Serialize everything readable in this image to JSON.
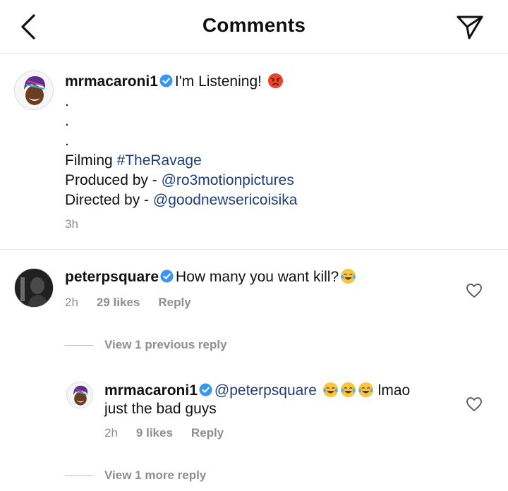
{
  "header": {
    "title": "Comments"
  },
  "caption": {
    "username": "mrmacaroni1",
    "text": "I'm Listening!",
    "dot": ".",
    "filming_label": "Filming",
    "filming_tag": "#TheRavage",
    "produced_label": "Produced by -",
    "produced_handle": "@ro3motionpictures",
    "directed_label": "Directed by -",
    "directed_handle": "@goodnewsericoisika",
    "time": "3h",
    "emoji": "angry-face-emoji"
  },
  "comment": {
    "username": "peterpsquare",
    "text": "How many you want kill?",
    "emoji": "tears-of-joy-emoji",
    "time": "2h",
    "likes": "29 likes",
    "reply_label": "Reply",
    "view_replies": "View 1 previous reply"
  },
  "reply": {
    "username": "mrmacaroni1",
    "mention": "@peterpsquare",
    "text_after_emoji": "lmao",
    "text_line2": "just the bad guys",
    "emoji": "tears-of-joy-emoji",
    "time": "2h",
    "likes": "9 likes",
    "reply_label": "Reply"
  },
  "more_replies": "View 1 more reply",
  "colors": {
    "link": "#1c3f7b",
    "verified": "#3897f0",
    "meta": "#8e8e8e"
  }
}
